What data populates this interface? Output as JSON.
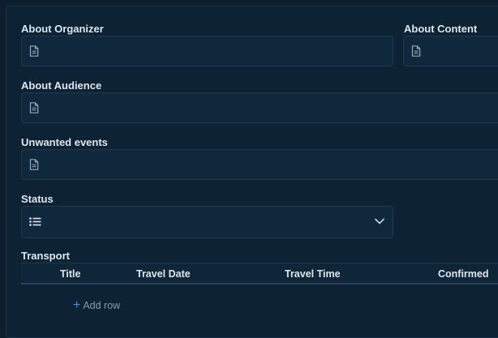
{
  "fields": {
    "about_organizer": {
      "label": "About Organizer",
      "value": ""
    },
    "about_content": {
      "label": "About Content",
      "value": ""
    },
    "about_audience": {
      "label": "About Audience",
      "value": ""
    },
    "unwanted_events": {
      "label": "Unwanted events",
      "value": ""
    },
    "status": {
      "label": "Status",
      "value": ""
    }
  },
  "transport": {
    "label": "Transport",
    "columns": [
      "Title",
      "Travel Date",
      "Travel Time",
      "Confirmed"
    ],
    "rows": [],
    "add_row_label": "Add row"
  },
  "colors": {
    "background": "#0b1f2e",
    "field_bg": "#10283b",
    "border": "#22394c",
    "text": "#dde6ee",
    "accent": "#4a8fd6"
  }
}
